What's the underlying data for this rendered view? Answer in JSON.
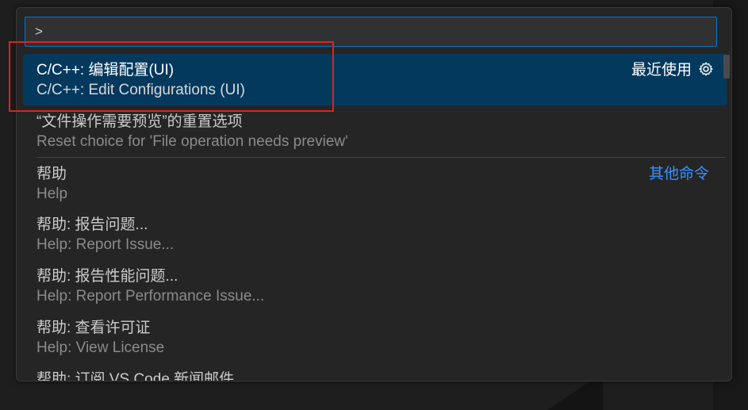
{
  "command_palette": {
    "input_value": ">",
    "items": [
      {
        "label": "C/C++: 编辑配置(UI)",
        "detail": "C/C++: Edit Configurations (UI)",
        "right": "最近使用",
        "icon": "gear-icon",
        "selected": true
      },
      {
        "label": "“文件操作需要预览”的重置选项",
        "detail": "Reset choice for 'File operation needs preview'"
      },
      {
        "label": "帮助",
        "detail": "Help",
        "right_link": "其他命令"
      },
      {
        "label": "帮助: 报告问题...",
        "detail": "Help: Report Issue..."
      },
      {
        "label": "帮助: 报告性能问题...",
        "detail": "Help: Report Performance Issue..."
      },
      {
        "label": "帮助: 查看许可证",
        "detail": "Help: View License"
      },
      {
        "label": "帮助: 订阅 VS Code 新闻邮件",
        "detail": ""
      }
    ]
  },
  "colors": {
    "accent": "#0078d4",
    "selected_bg": "#04395e",
    "link": "#3794ff",
    "annotation": "#e0221f"
  }
}
